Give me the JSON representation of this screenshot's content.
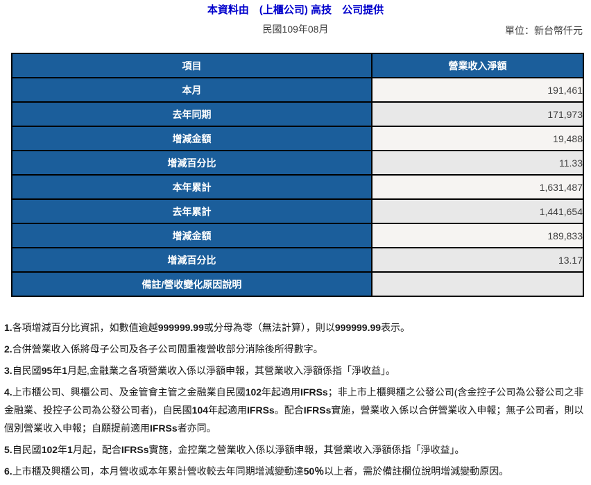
{
  "header": {
    "provider_line": "本資料由　(上櫃公司) 高技　公司提供",
    "period": "民國109年08月",
    "unit": "單位：新台幣仟元"
  },
  "table": {
    "columns": [
      "項目",
      "營業收入淨額"
    ],
    "rows": [
      {
        "label": "本月",
        "value": "191,461"
      },
      {
        "label": "去年同期",
        "value": "171,973"
      },
      {
        "label": "增減金額",
        "value": "19,488"
      },
      {
        "label": "增減百分比",
        "value": "11.33"
      },
      {
        "label": "本年累計",
        "value": "1,631,487"
      },
      {
        "label": "去年累計",
        "value": "1,441,654"
      },
      {
        "label": "增減金額",
        "value": "189,833"
      },
      {
        "label": "增減百分比",
        "value": "13.17"
      },
      {
        "label": "備註/營收變化原因說明",
        "value": ""
      }
    ]
  },
  "footnotes": [
    "1.各項增減百分比資訊，如數值逾越999999.99或分母為零（無法計算），則以999999.99表示。",
    "2.合併營業收入係將母子公司及各子公司間重複營收部分消除後所得數字。",
    "3.自民國95年1月起,金融業之各項營業收入係以淨額申報，其營業收入淨額係指「淨收益」。",
    "4.上市櫃公司、興櫃公司、及金管會主管之金融業自民國102年起適用IFRSs；非上市上櫃興櫃之公發公司(含金控子公司為公發公司之非金融業、投控子公司為公發公司者)，自民國104年起適用IFRSs。配合IFRSs實施，營業收入係以合併營業收入申報；無子公司者，則以個別營業收入申報；自願提前適用IFRSs者亦同。",
    "5.自民國102年1月起，配合IFRSs實施，金控業之營業收入係以淨額申報，其營業收入淨額係指「淨收益」。",
    "6.上市櫃及興櫃公司，本月營收或本年累計營收較去年同期增減變動達50％以上者，需於備註欄位說明增減變動原因。"
  ],
  "colors": {
    "header_blue": "#1b5e9b",
    "link_blue": "#0000cc",
    "row_light": "#f6f4f2",
    "row_gray": "#e8e8e8"
  }
}
